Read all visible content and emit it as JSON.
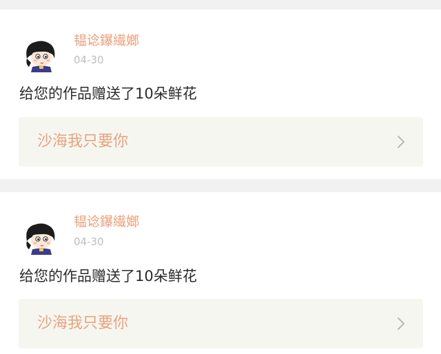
{
  "notifications": [
    {
      "username": "韫谂鑤繊嫏",
      "timestamp": "04-30",
      "message": "给您的作品赠送了10朵鲜花",
      "work_title": "沙海我只要你"
    },
    {
      "username": "韫谂鑤繊嫏",
      "timestamp": "04-30",
      "message": "给您的作品赠送了10朵鲜花",
      "work_title": "沙海我只要你"
    }
  ],
  "colors": {
    "accent": "#e9a27c",
    "timestamp": "#bdbdbd",
    "message": "#2b2b2b",
    "link_background": "#f6f6f1",
    "page_background": "#f1f1f1",
    "chevron": "#b8b8b8"
  },
  "icons": {
    "avatar": "cartoon-girl-avatar",
    "chevron": "chevron-right-icon"
  }
}
